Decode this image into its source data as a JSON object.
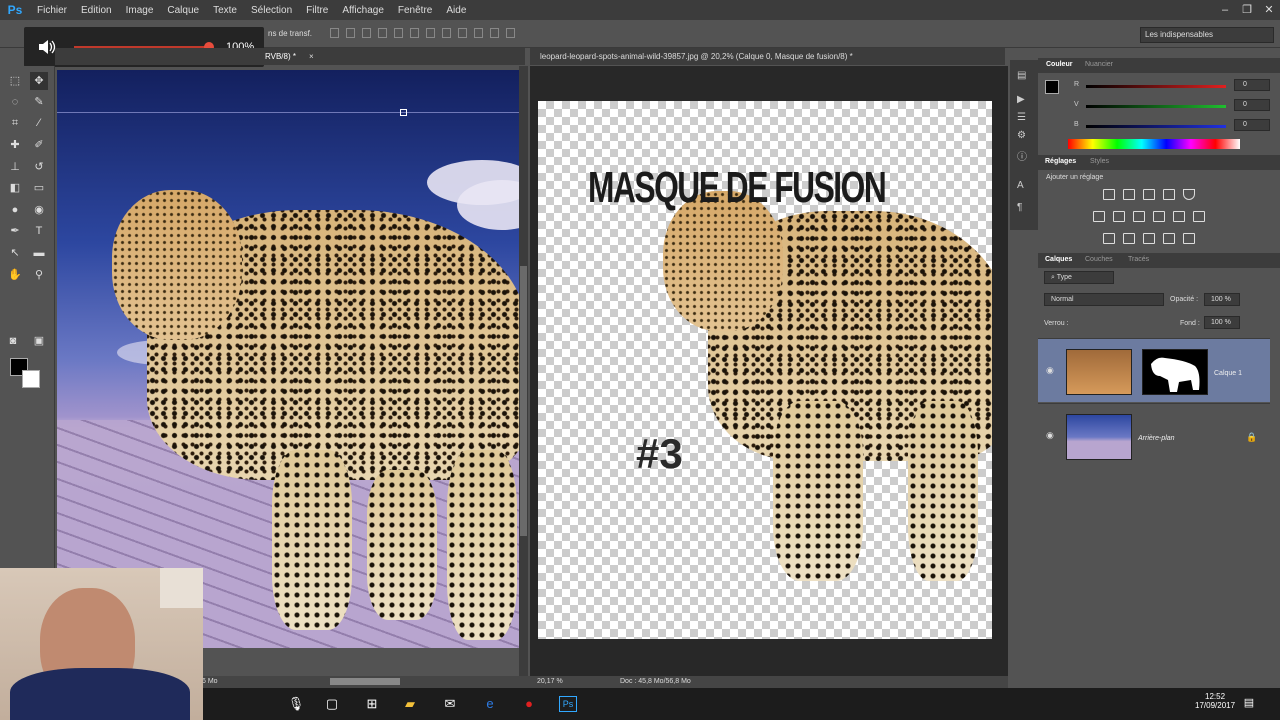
{
  "app": {
    "logo": "Ps"
  },
  "menu": [
    "Fichier",
    "Edition",
    "Image",
    "Calque",
    "Texte",
    "Sélection",
    "Filtre",
    "Affichage",
    "Fenêtre",
    "Aide"
  ],
  "window_controls": [
    "–",
    "❐",
    "✕"
  ],
  "options_bar": {
    "partial_text": "ns de transf.",
    "workspace": "Les indispensables"
  },
  "volume": {
    "percent_label": "100%",
    "level": 1.0
  },
  "doc1": {
    "tab_label": "RVB/8) *",
    "close": "×",
    "status": "6 Mo"
  },
  "doc2": {
    "tab_label": "leopard-leopard-spots-animal-wild-39857.jpg @ 20,2% (Calque 0, Masque de fusion/8) *",
    "close": "×",
    "overlay_title": "MASQUE DE FUSION",
    "overlay_number": "#3",
    "zoom": "20,17 %",
    "doc_size": "Doc : 45,8 Mo/56,8 Mo"
  },
  "color_panel": {
    "tabs": [
      "Couleur",
      "Nuancier"
    ],
    "rows": [
      {
        "label": "R",
        "value": "0",
        "color": "#e02020"
      },
      {
        "label": "V",
        "value": "0",
        "color": "#1fbf2f"
      },
      {
        "label": "B",
        "value": "0",
        "color": "#2030e0"
      }
    ]
  },
  "adjust_panel": {
    "tabs": [
      "Réglages",
      "Styles"
    ],
    "title": "Ajouter un réglage"
  },
  "layers_panel": {
    "tabs": [
      "Calques",
      "Couches",
      "Tracés"
    ],
    "filter": "Type",
    "blend_mode": "Normal",
    "opacity_label": "Opacité :",
    "opacity_value": "100 %",
    "lock_label": "Verrou :",
    "fill_label": "Fond :",
    "fill_value": "100 %",
    "layers": [
      {
        "name": "Calque 1",
        "selected": true
      },
      {
        "name": "Arrière-plan",
        "selected": false
      }
    ]
  },
  "taskbar": {
    "time": "12:52",
    "date": "17/09/2017"
  },
  "icons": {
    "speaker": "speaker-icon",
    "eye": "eye-icon",
    "lock": "lock-icon",
    "mic": "microphone-icon",
    "task_view": "task-view-icon",
    "start": "windows-icon",
    "explorer": "folder-icon",
    "mail": "mail-icon",
    "edge": "edge-icon",
    "record": "record-icon",
    "ps": "photoshop-icon",
    "notifications": "notification-icon"
  }
}
